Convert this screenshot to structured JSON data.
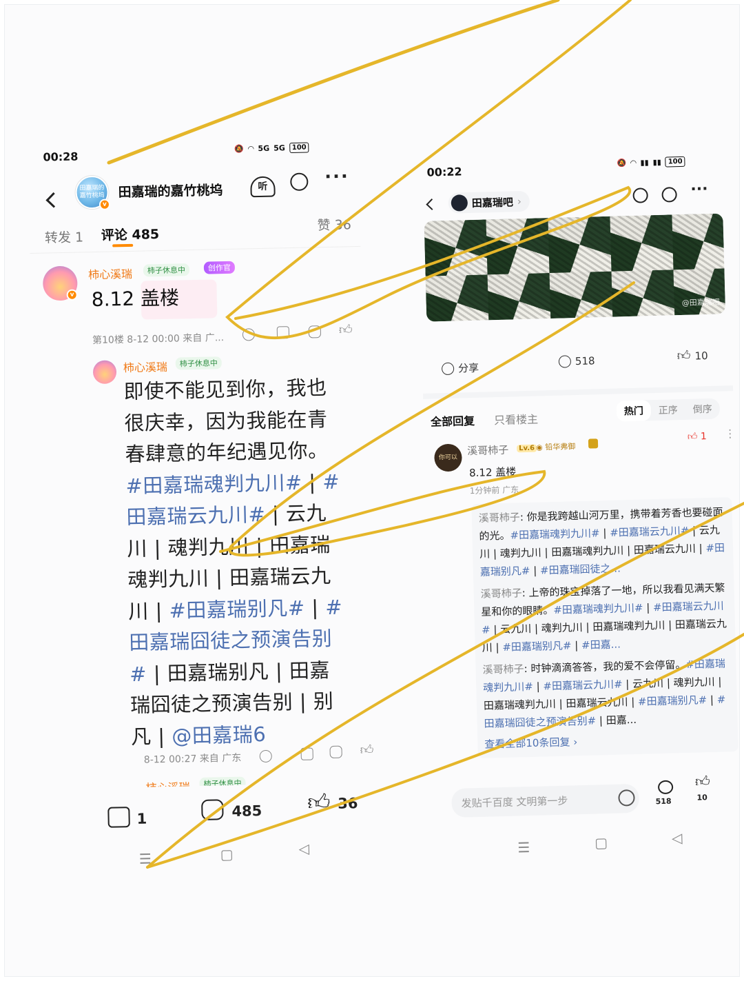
{
  "left": {
    "status": {
      "time": "00:28",
      "network": "5G",
      "network2": "5G",
      "battery": "100"
    },
    "header": {
      "avatar_text": "田嘉瑞的嘉竹桃坞",
      "title": "田嘉瑞的嘉竹桃坞"
    },
    "tabs": {
      "repost": "转发 1",
      "comments": "评论 485",
      "likes": "赞 36"
    },
    "floor": {
      "author": "柿心溪瑞",
      "status_chip": "柿子休息中",
      "creator_chip": "创作官",
      "text": "8.12 盖楼",
      "meta": "第10楼 8-12 00:00 来自 广..."
    },
    "reply": {
      "author": "柿心溪瑞",
      "status_chip": "柿子休息中",
      "lines": [
        [
          {
            "t": "即使不能见到你，我也"
          }
        ],
        [
          {
            "t": "很庆幸，因为我能在青"
          }
        ],
        [
          {
            "t": "春肆意的年纪遇见你。"
          }
        ],
        [
          {
            "t": "#田嘉瑞魂判九川#",
            "tag": true
          },
          {
            "t": " | "
          },
          {
            "t": "#",
            "tag": true
          }
        ],
        [
          {
            "t": "田嘉瑞云九川#",
            "tag": true
          },
          {
            "t": " | 云九"
          }
        ],
        [
          {
            "t": "川 | 魂判九川 | 田嘉瑞"
          }
        ],
        [
          {
            "t": "魂判九川 | 田嘉瑞云九"
          }
        ],
        [
          {
            "t": "川 | "
          },
          {
            "t": "#田嘉瑞别凡#",
            "tag": true
          },
          {
            "t": " | "
          },
          {
            "t": "#",
            "tag": true
          }
        ],
        [
          {
            "t": "田嘉瑞囧徒之预演告别",
            "tag": true
          }
        ],
        [
          {
            "t": "#",
            "tag": true
          },
          {
            "t": " | 田嘉瑞别凡 | 田嘉"
          }
        ],
        [
          {
            "t": "瑞囧徒之预演告别 | 别"
          }
        ],
        [
          {
            "t": "凡 | "
          },
          {
            "t": "@田嘉瑞6",
            "tag": true
          }
        ]
      ],
      "meta": "8-12 00:27 来自 广东"
    },
    "next_author": "柿心溪瑞",
    "next_chip": "柿子休息中",
    "bottom": {
      "repost": "1",
      "comments": "485",
      "likes": "36"
    },
    "nav": {
      "menu": "☰",
      "home": "▢",
      "back": "◁"
    }
  },
  "right": {
    "status": {
      "time": "00:22",
      "battery": "100"
    },
    "header": {
      "forum": "田嘉瑞吧"
    },
    "image": {
      "watermark": "@田嘉瑞吧"
    },
    "actions": {
      "share": "分享",
      "comments": "518",
      "likes": "10"
    },
    "filter": {
      "all": "全部回复",
      "owner": "只看楼主",
      "hot": "热门",
      "asc": "正序",
      "desc": "倒序"
    },
    "comment": {
      "avatar_text": "你可以",
      "author": "溪哥柿子",
      "level": "Lv.6",
      "badge": "铅华弗御",
      "like_count": "1",
      "text": "8.12 盖楼",
      "meta": "1分钟前 广东"
    },
    "sub_replies": [
      {
        "name": "溪哥柿子",
        "segments": [
          {
            "t": ": 你是我跨越山河万里，携带着芳香也要碰面的光。"
          },
          {
            "t": "#田嘉瑞魂判九川#",
            "tag": true
          },
          {
            "t": " | "
          },
          {
            "t": "#田嘉瑞云九川#",
            "tag": true
          },
          {
            "t": " | 云九川 | 魂判九川 | 田嘉瑞魂判九川 | 田嘉瑞云九川 | "
          },
          {
            "t": "#田嘉瑞别凡#",
            "tag": true
          },
          {
            "t": " | "
          },
          {
            "t": "#田嘉瑞囧徒之...",
            "tag": true
          }
        ]
      },
      {
        "name": "溪哥柿子",
        "segments": [
          {
            "t": ": 上帝的珠宝掉落了一地，所以我看见满天繁星和你的眼睛。"
          },
          {
            "t": "#田嘉瑞魂判九川#",
            "tag": true
          },
          {
            "t": " | "
          },
          {
            "t": "#田嘉瑞云九川#",
            "tag": true
          },
          {
            "t": " | 云九川 | 魂判九川 | 田嘉瑞魂判九川 | 田嘉瑞云九川 | "
          },
          {
            "t": "#田嘉瑞别凡#",
            "tag": true
          },
          {
            "t": " | "
          },
          {
            "t": "#田嘉...",
            "tag": true
          }
        ]
      },
      {
        "name": "溪哥柿子",
        "segments": [
          {
            "t": ": 时钟滴滴答答，我的爱不会停留。"
          },
          {
            "t": "#田嘉瑞魂判九川#",
            "tag": true
          },
          {
            "t": " | "
          },
          {
            "t": "#田嘉瑞云九川#",
            "tag": true
          },
          {
            "t": " | 云九川 | 魂判九川 | 田嘉瑞魂判九川 | 田嘉瑞云九川 | "
          },
          {
            "t": "#田嘉瑞别凡#",
            "tag": true
          },
          {
            "t": " | "
          },
          {
            "t": "#田嘉瑞囧徒之预演告别#",
            "tag": true
          },
          {
            "t": " | 田嘉..."
          }
        ]
      }
    ],
    "see_all": "查看全部10条回复 ›",
    "input": {
      "placeholder": "发贴千百度 文明第一步"
    },
    "bottom": {
      "comments": "518",
      "likes": "10"
    },
    "nav": {
      "menu": "☰",
      "home": "▢",
      "back": "◁"
    }
  },
  "colors": {
    "annotation": "#e5b62a",
    "tag": "#4d70b1",
    "name_orange": "#f07a17"
  },
  "icons": [
    "mute-icon",
    "wifi-icon",
    "signal-icon",
    "battery-icon",
    "back-icon",
    "listen-icon",
    "search-icon",
    "more-icon",
    "edit-icon",
    "share-icon",
    "comment-icon",
    "like-icon",
    "emoji-icon"
  ]
}
